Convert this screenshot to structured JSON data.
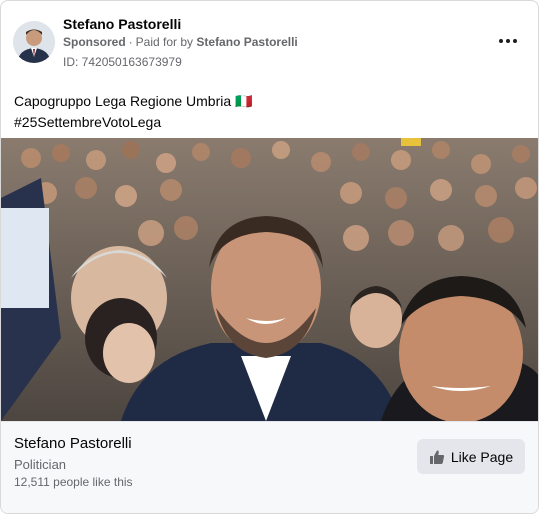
{
  "post": {
    "author_name": "Stefano Pastorelli",
    "sponsored_label": "Sponsored",
    "paid_for_prefix": "Paid for by",
    "paid_for_name": "Stefano Pastorelli",
    "ad_id": "ID: 742050163673979",
    "text_line1": "Capogruppo Lega Regione Umbria 🇮🇹",
    "text_line2": "#25SettembreVotoLega",
    "more_icon": "more-horizontal-icon"
  },
  "footer": {
    "page_name": "Stefano Pastorelli",
    "category": "Politician",
    "likes_text": "12,511 people like this",
    "like_button_label": "Like Page",
    "like_icon": "thumbs-up-icon"
  },
  "colors": {
    "text_primary": "#050505",
    "text_secondary": "#65676b",
    "button_bg": "#e4e6eb",
    "footer_bg": "#f7f8fa"
  }
}
